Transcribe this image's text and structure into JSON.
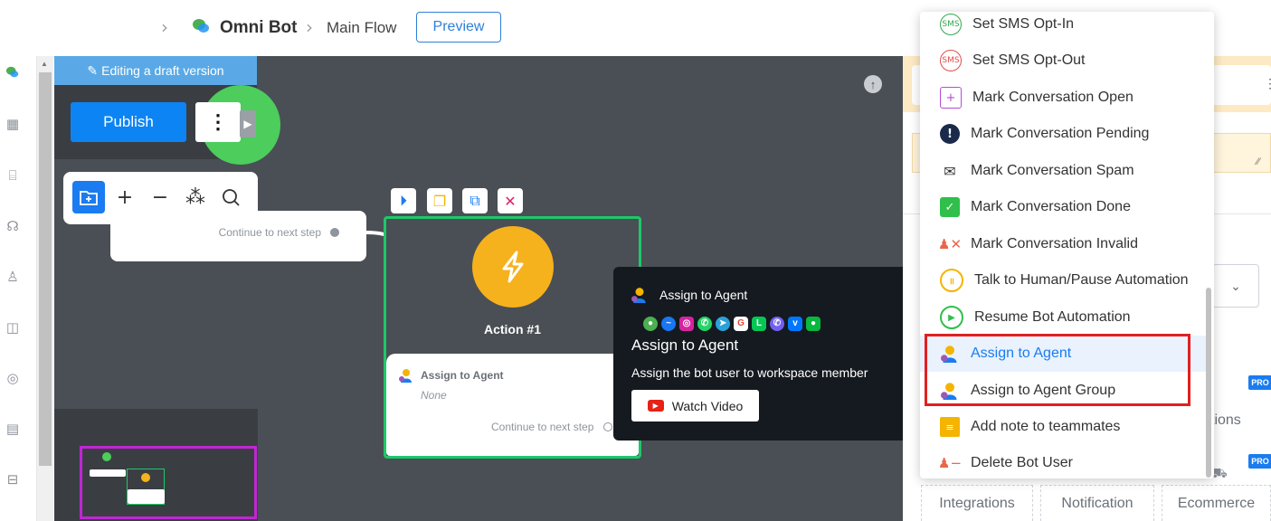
{
  "topbar": {
    "bot_name": "Omni Bot",
    "flow_name": "Main Flow",
    "preview_label": "Preview"
  },
  "rail_icons": [
    "chat-icon",
    "dashboard-icon",
    "broadcast-icon",
    "support-icon",
    "contacts-icon",
    "inbox-icon",
    "help-icon",
    "reports-icon",
    "archive-icon"
  ],
  "canvas": {
    "draft_label": "Editing a draft version",
    "publish_label": "Publish",
    "more_label": "⋮",
    "continue_label": "Continue to next step",
    "action_title": "Action #1",
    "action_card": {
      "title": "Assign to Agent",
      "value": "None",
      "continue": "Continue to next step"
    }
  },
  "tooltip": {
    "header": "Assign to Agent",
    "title": "Assign to Agent",
    "description": "Assign the bot user to workspace member",
    "button": "Watch Video",
    "channel_icons": [
      "webchat-icon",
      "messenger-icon",
      "instagram-icon",
      "whatsapp-icon",
      "telegram-icon",
      "google-icon",
      "line-icon",
      "viber-icon",
      "vk-icon",
      "wechat-icon"
    ]
  },
  "menu": {
    "items": [
      {
        "label": "Set SMS Opt-In",
        "icon": "sms-optin-icon",
        "color": "#2fa84f"
      },
      {
        "label": "Set SMS Opt-Out",
        "icon": "sms-optout-icon",
        "color": "#e54a4a"
      },
      {
        "label": "Mark Conversation Open",
        "icon": "conversation-open-icon",
        "color": "#b54ad6"
      },
      {
        "label": "Mark Conversation Pending",
        "icon": "conversation-pending-icon",
        "color": "#1b2a4a"
      },
      {
        "label": "Mark Conversation Spam",
        "icon": "conversation-spam-icon",
        "color": "#333333"
      },
      {
        "label": "Mark Conversation Done",
        "icon": "conversation-done-icon",
        "color": "#2fbf4a"
      },
      {
        "label": "Mark Conversation Invalid",
        "icon": "conversation-invalid-icon",
        "color": "#e8674a"
      },
      {
        "label": "Talk to Human/Pause Automation",
        "icon": "pause-automation-icon",
        "color": "#f5b400"
      },
      {
        "label": "Resume Bot Automation",
        "icon": "resume-automation-icon",
        "color": "#2fbf4a"
      },
      {
        "label": "Assign to Agent",
        "icon": "assign-agent-icon",
        "color": "#1a7cf0"
      },
      {
        "label": "Assign to Agent Group",
        "icon": "assign-agent-group-icon",
        "color": "#1a7cf0"
      },
      {
        "label": "Add note to teammates",
        "icon": "note-icon",
        "color": "#f5b400"
      },
      {
        "label": "Delete Bot User",
        "icon": "delete-user-icon",
        "color": "#e8674a"
      }
    ]
  },
  "right_panel": {
    "pro_label": "PRO",
    "tabs": [
      "Integrations",
      "Notification",
      "Ecommerce"
    ],
    "partial_text": "tions"
  }
}
